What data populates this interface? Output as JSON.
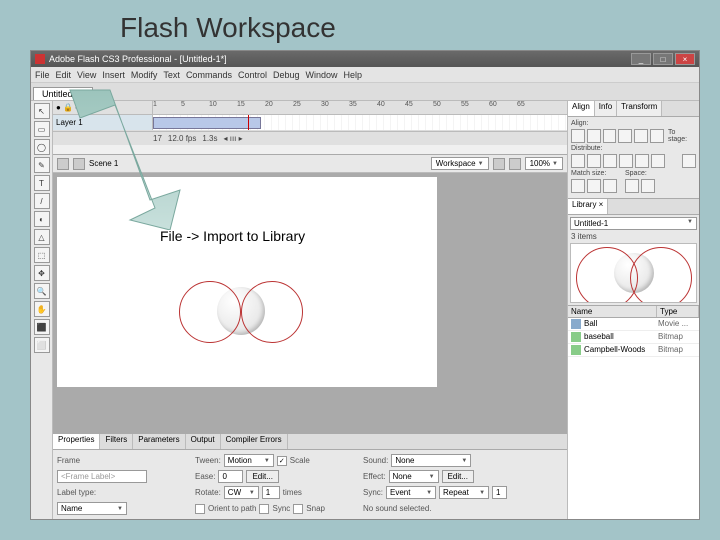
{
  "slide": {
    "title": "Flash Workspace",
    "annotation": "File -> Import to Library"
  },
  "window": {
    "title": "Adobe Flash CS3 Professional - [Untitled-1*]",
    "buttons": {
      "min": "_",
      "max": "□",
      "close": "×"
    }
  },
  "menubar": [
    "File",
    "Edit",
    "View",
    "Insert",
    "Modify",
    "Text",
    "Commands",
    "Control",
    "Debug",
    "Window",
    "Help"
  ],
  "document_tab": "Untitled-1*",
  "timeline": {
    "layer": "Layer 1",
    "ticks": [
      "1",
      "5",
      "10",
      "15",
      "20",
      "25",
      "30",
      "35",
      "40",
      "45",
      "50",
      "55",
      "60",
      "65"
    ],
    "status": {
      "frame": "17",
      "fps": "12.0 fps",
      "time": "1.3s"
    }
  },
  "editbar": {
    "scene": "Scene 1",
    "workspace": "Workspace",
    "zoom": "100%"
  },
  "right_panel": {
    "tabs_top": [
      "Align",
      "Info",
      "Transform"
    ],
    "align": {
      "sections": [
        "Align:",
        "Distribute:",
        "Match size:",
        "Space:",
        "To stage:"
      ]
    },
    "library": {
      "tab": "Library ×",
      "doc": "Untitled-1",
      "count": "3 items",
      "columns": [
        "Name",
        "Type"
      ],
      "items": [
        {
          "name": "Ball",
          "type": "Movie ..."
        },
        {
          "name": "baseball",
          "type": "Bitmap"
        },
        {
          "name": "Campbell-Woods",
          "type": "Bitmap"
        }
      ]
    }
  },
  "properties": {
    "tabs": [
      "Properties",
      "Filters",
      "Parameters",
      "Output",
      "Compiler Errors"
    ],
    "frame_label": "Frame",
    "label_placeholder": "<Frame Label>",
    "label_type_label": "Label type:",
    "label_type_value": "Name",
    "tween_label": "Tween:",
    "tween_value": "Motion",
    "scale_label": "Scale",
    "scale_checked": "✓",
    "ease_label": "Ease:",
    "ease_value": "0",
    "edit_btn": "Edit...",
    "rotate_label": "Rotate:",
    "rotate_value": "CW",
    "rotate_times": "1",
    "rotate_times_label": "times",
    "orient_label": "Orient to path",
    "sync_label": "Sync",
    "snap_label": "Snap",
    "sound_label": "Sound:",
    "sound_value": "None",
    "effect_label": "Effect:",
    "effect_value": "None",
    "effect_edit": "Edit...",
    "sync2_label": "Sync:",
    "sync2_value": "Event",
    "repeat_value": "Repeat",
    "repeat_times": "1",
    "nosound": "No sound selected."
  },
  "tools": [
    "↖",
    "▭",
    "◯",
    "✎",
    "T",
    "/",
    "◐",
    "△",
    "⬚",
    "✥",
    "🔍",
    "✋",
    "⬛",
    "⬜"
  ]
}
